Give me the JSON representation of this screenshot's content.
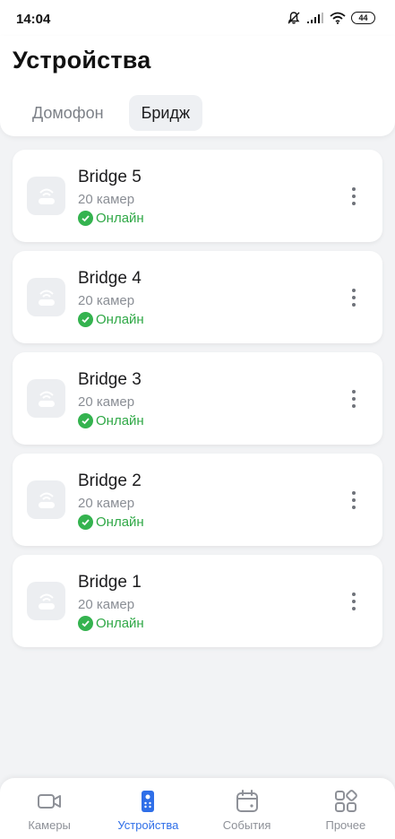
{
  "status_bar": {
    "time": "14:04",
    "battery": "44"
  },
  "header": {
    "title": "Устройства",
    "tabs": [
      {
        "label": "Домофон",
        "active": false
      },
      {
        "label": "Бридж",
        "active": true
      }
    ]
  },
  "devices": [
    {
      "name": "Bridge 5",
      "cameras": "20 камер",
      "status": "Онлайн"
    },
    {
      "name": "Bridge 4",
      "cameras": "20 камер",
      "status": "Онлайн"
    },
    {
      "name": "Bridge 3",
      "cameras": "20 камер",
      "status": "Онлайн"
    },
    {
      "name": "Bridge 2",
      "cameras": "20 камер",
      "status": "Онлайн"
    },
    {
      "name": "Bridge 1",
      "cameras": "20 камер",
      "status": "Онлайн"
    }
  ],
  "bottom_nav": {
    "items": [
      {
        "label": "Камеры",
        "icon": "camera-icon",
        "active": false
      },
      {
        "label": "Устройства",
        "icon": "intercom-icon",
        "active": true
      },
      {
        "label": "События",
        "icon": "calendar-icon",
        "active": false
      },
      {
        "label": "Прочее",
        "icon": "grid-icon",
        "active": false
      }
    ]
  },
  "colors": {
    "accent": "#2f6fe8",
    "online": "#2fa846",
    "background": "#f2f3f5"
  }
}
